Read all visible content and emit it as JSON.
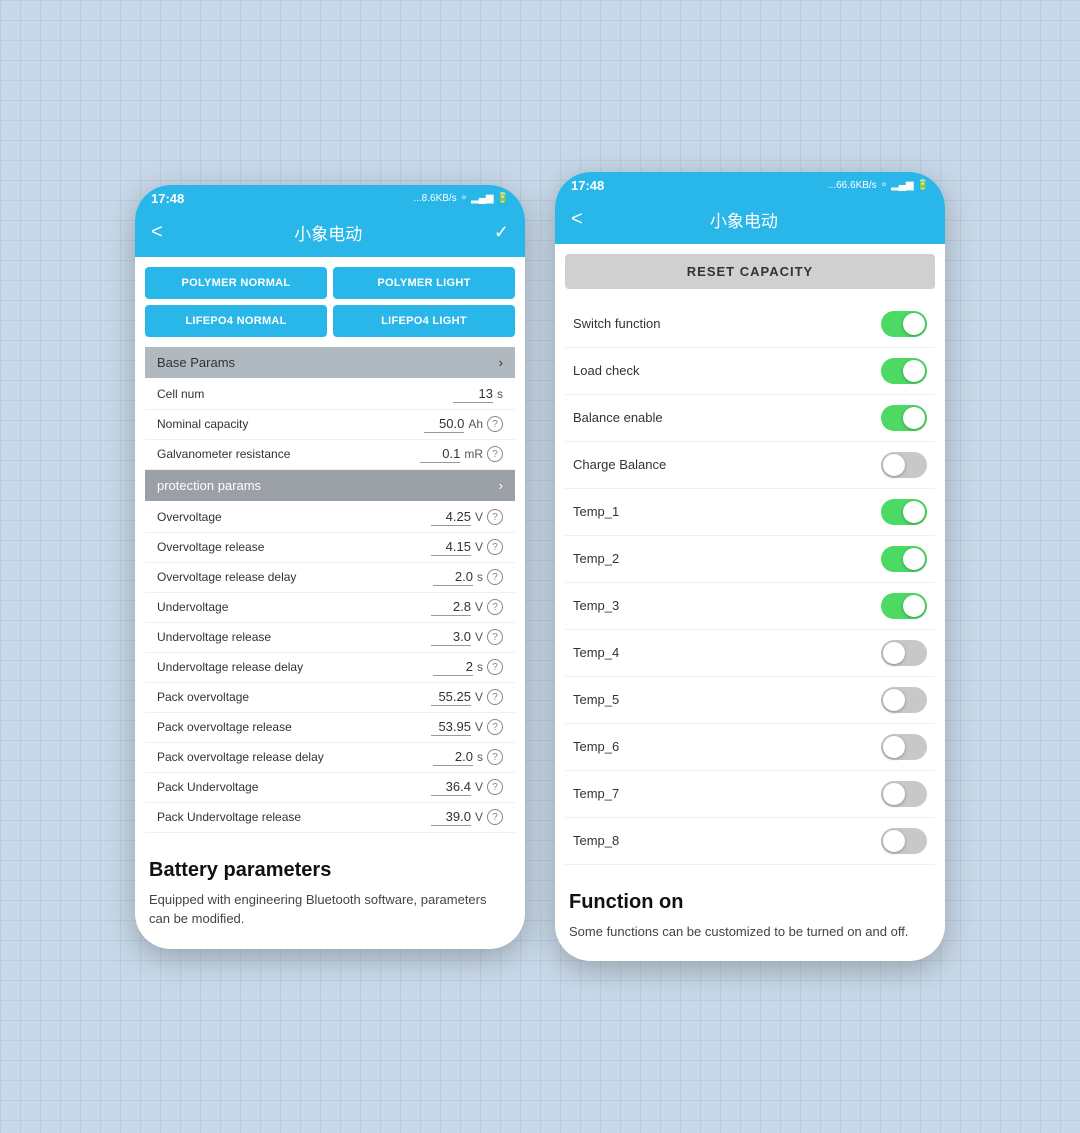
{
  "left_phone": {
    "status_bar": {
      "time": "17:48",
      "network": "...8.6KB/s",
      "icons": "🔵 📶 📶 🔋"
    },
    "title_bar": {
      "back": "<",
      "title": "小象电动",
      "check": "✓"
    },
    "preset_buttons": [
      {
        "id": "polymer-normal",
        "label": "POLYMER NORMAL"
      },
      {
        "id": "polymer-light",
        "label": "POLYMER LIGHT"
      },
      {
        "id": "lifepo4-normal",
        "label": "LIFEPO4 NORMAL"
      },
      {
        "id": "lifepo4-light",
        "label": "LIFEPO4 LIGHT"
      }
    ],
    "sections": [
      {
        "id": "base-params",
        "title": "Base Params",
        "type": "collapsible",
        "rows": [
          {
            "label": "Cell num",
            "value": "13",
            "unit": "s",
            "has_help": false
          },
          {
            "label": "Nominal capacity",
            "value": "50.0",
            "unit": "Ah",
            "has_help": true
          },
          {
            "label": "Galvanometer resistance",
            "value": "0.1",
            "unit": "mR",
            "has_help": true
          }
        ]
      },
      {
        "id": "protection-params",
        "title": "protection params",
        "type": "collapsible",
        "rows": [
          {
            "label": "Overvoltage",
            "value": "4.25",
            "unit": "V",
            "has_help": true
          },
          {
            "label": "Overvoltage release",
            "value": "4.15",
            "unit": "V",
            "has_help": true
          },
          {
            "label": "Overvoltage release delay",
            "value": "2.0",
            "unit": "s",
            "has_help": true
          },
          {
            "label": "Undervoltage",
            "value": "2.8",
            "unit": "V",
            "has_help": true
          },
          {
            "label": "Undervoltage release",
            "value": "3.0",
            "unit": "V",
            "has_help": true
          },
          {
            "label": "Undervoltage release delay",
            "value": "2",
            "unit": "s",
            "has_help": true
          },
          {
            "label": "Pack overvoltage",
            "value": "55.25",
            "unit": "V",
            "has_help": true
          },
          {
            "label": "Pack overvoltage release",
            "value": "53.95",
            "unit": "V",
            "has_help": true
          },
          {
            "label": "Pack overvoltage release delay",
            "value": "2.0",
            "unit": "s",
            "has_help": true
          },
          {
            "label": "Pack Undervoltage",
            "value": "36.4",
            "unit": "V",
            "has_help": true
          },
          {
            "label": "Pack Undervoltage release",
            "value": "39.0",
            "unit": "V",
            "has_help": true
          }
        ]
      }
    ],
    "caption": {
      "title": "Battery parameters",
      "text": "Equipped with engineering Bluetooth software, parameters can be modified."
    }
  },
  "right_phone": {
    "status_bar": {
      "time": "17:48",
      "network": "...66.6KB/s",
      "icons": "🔵 📶 📶 🔋"
    },
    "title_bar": {
      "back": "<",
      "title": "小象电动"
    },
    "reset_button": "RESET CAPACITY",
    "function_rows": [
      {
        "id": "switch-function",
        "label": "Switch function",
        "state": "on"
      },
      {
        "id": "load-check",
        "label": "Load check",
        "state": "on"
      },
      {
        "id": "balance-enable",
        "label": "Balance enable",
        "state": "on"
      },
      {
        "id": "charge-balance",
        "label": "Charge Balance",
        "state": "off"
      },
      {
        "id": "temp-1",
        "label": "Temp_1",
        "state": "on"
      },
      {
        "id": "temp-2",
        "label": "Temp_2",
        "state": "on"
      },
      {
        "id": "temp-3",
        "label": "Temp_3",
        "state": "on"
      },
      {
        "id": "temp-4",
        "label": "Temp_4",
        "state": "off"
      },
      {
        "id": "temp-5",
        "label": "Temp_5",
        "state": "off"
      },
      {
        "id": "temp-6",
        "label": "Temp_6",
        "state": "off"
      },
      {
        "id": "temp-7",
        "label": "Temp_7",
        "state": "off"
      },
      {
        "id": "temp-8",
        "label": "Temp_8",
        "state": "off"
      }
    ],
    "caption": {
      "title": "Function on",
      "text": "Some functions can be customized to be turned on and off."
    }
  }
}
